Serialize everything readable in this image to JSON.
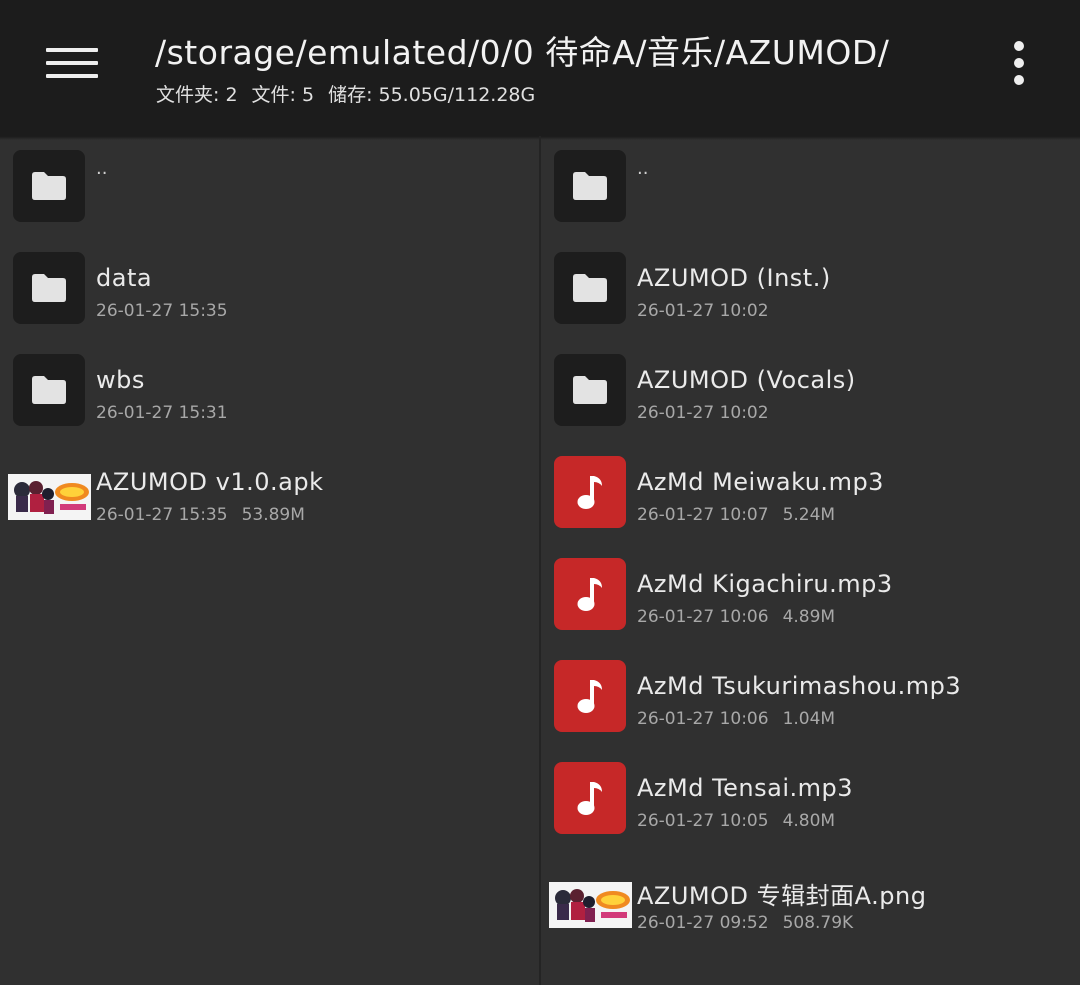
{
  "header": {
    "path": "/storage/emulated/0/0 待命A/音乐/AZUMOD/",
    "folders_label": "文件夹: 2",
    "files_label": "文件: 5",
    "storage_label": "储存: 55.05G/112.28G"
  },
  "left_pane": {
    "items": [
      {
        "name": "..",
        "date": "",
        "size": "",
        "type": "parent"
      },
      {
        "name": "data",
        "date": "26-01-27 15:35",
        "size": "",
        "type": "folder"
      },
      {
        "name": "wbs",
        "date": "26-01-27 15:31",
        "size": "",
        "type": "folder"
      },
      {
        "name": "AZUMOD v1.0.apk",
        "date": "26-01-27 15:35",
        "size": "53.89M",
        "type": "apk"
      }
    ]
  },
  "right_pane": {
    "items": [
      {
        "name": "..",
        "date": "",
        "size": "",
        "type": "parent"
      },
      {
        "name": "AZUMOD (Inst.)",
        "date": "26-01-27 10:02",
        "size": "",
        "type": "folder"
      },
      {
        "name": "AZUMOD (Vocals)",
        "date": "26-01-27 10:02",
        "size": "",
        "type": "folder"
      },
      {
        "name": "AzMd Meiwaku.mp3",
        "date": "26-01-27 10:07",
        "size": "5.24M",
        "type": "music"
      },
      {
        "name": "AzMd Kigachiru.mp3",
        "date": "26-01-27 10:06",
        "size": "4.89M",
        "type": "music"
      },
      {
        "name": "AzMd Tsukurimashou.mp3",
        "date": "26-01-27 10:06",
        "size": "1.04M",
        "type": "music"
      },
      {
        "name": "AzMd Tensai.mp3",
        "date": "26-01-27 10:05",
        "size": "4.80M",
        "type": "music"
      },
      {
        "name": "AZUMOD 专辑封面A.png",
        "date": "26-01-27 09:52",
        "size": "508.79K",
        "type": "image"
      }
    ]
  },
  "icons": {
    "menu": "hamburger-menu-icon",
    "more": "more-vertical-icon",
    "folder": "folder-icon",
    "music": "music-note-icon",
    "thumbnail": "image-thumbnail"
  },
  "colors": {
    "topbar": "#1c1c1c",
    "background": "#303030",
    "folder_tile": "#1d1d1d",
    "music_tile": "#c62828"
  }
}
